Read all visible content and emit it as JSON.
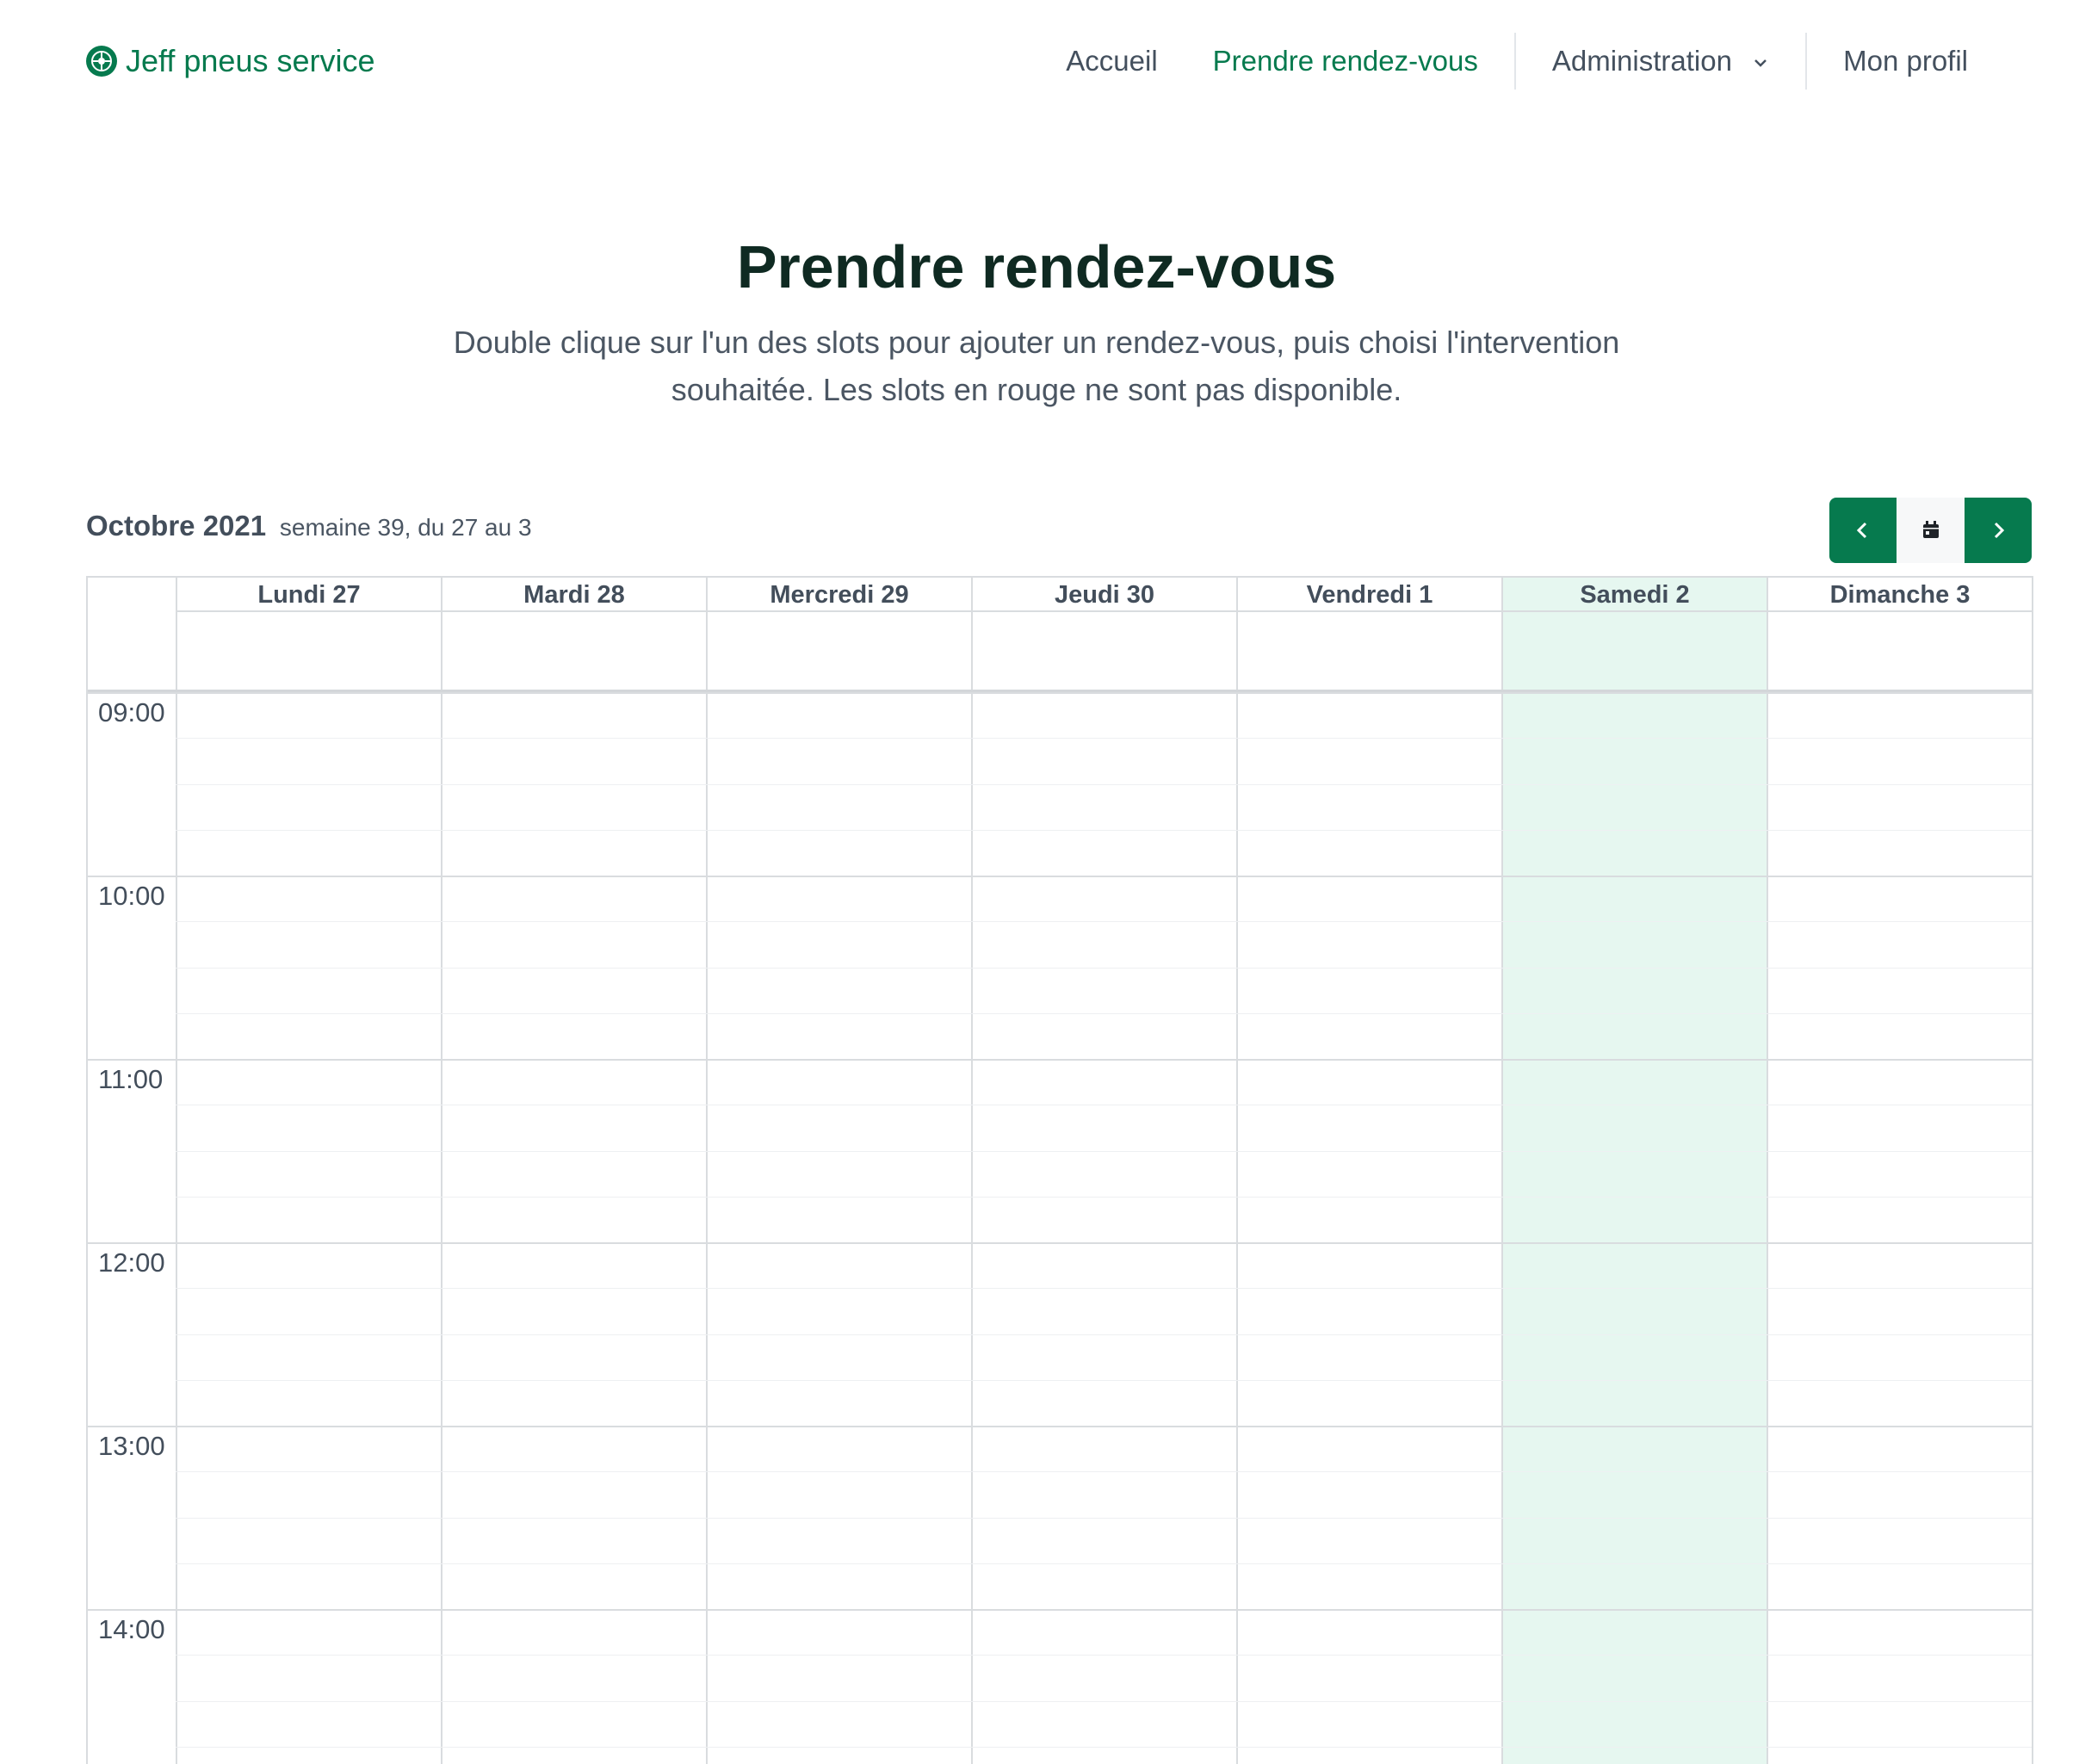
{
  "brand": {
    "name": "Jeff pneus service",
    "icon": "tire-icon",
    "color": "#067a4e"
  },
  "nav": {
    "items": [
      {
        "label": "Accueil",
        "active": false
      },
      {
        "label": "Prendre rendez-vous",
        "active": true
      },
      {
        "label": "Administration",
        "active": false,
        "dropdown": true
      },
      {
        "label": "Mon profil",
        "active": false
      }
    ]
  },
  "hero": {
    "title": "Prendre rendez-vous",
    "subtitle": "Double clique sur l'un des slots pour ajouter un rendez-vous, puis choisi l'intervention souhaitée. Les slots en rouge ne sont pas disponible."
  },
  "calendar": {
    "month": "Octobre 2021",
    "week_info": "semaine 39, du 27 au 3",
    "buttons": {
      "prev": "chevron-left-icon",
      "today": "calendar-icon",
      "next": "chevron-right-icon"
    },
    "days": [
      "Lundi 27",
      "Mardi 28",
      "Mercredi 29",
      "Jeudi 30",
      "Vendredi 1",
      "Samedi 2",
      "Dimanche 3"
    ],
    "today_index": 5,
    "hours": [
      "09:00",
      "10:00",
      "11:00",
      "12:00",
      "13:00",
      "14:00"
    ],
    "colors": {
      "accent": "#067a4e",
      "today_bg": "#e6f7f0",
      "grid": "#d9dcdf"
    }
  }
}
